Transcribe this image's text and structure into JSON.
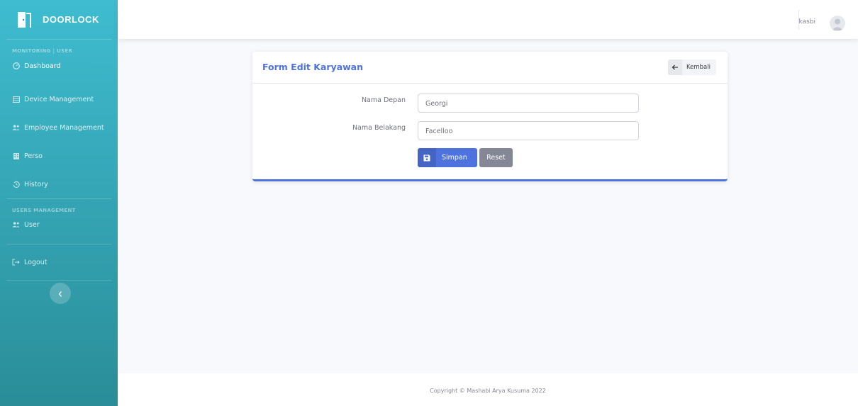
{
  "sidebar": {
    "brand": "DOORLOCK",
    "section_monitoring": "MONITORING | USER",
    "items": [
      {
        "label": "Dashboard",
        "icon": "dashboard-icon"
      },
      {
        "label": "Device Management",
        "icon": "table-icon"
      },
      {
        "label": "Employee Management",
        "icon": "users-icon"
      },
      {
        "label": "Perso",
        "icon": "building-icon"
      },
      {
        "label": "History",
        "icon": "history-icon"
      }
    ],
    "section_users": "USERS MANAGEMENT",
    "user_item": {
      "label": "User",
      "icon": "users-icon"
    },
    "logout_item": {
      "label": "Logout",
      "icon": "logout-icon"
    }
  },
  "topbar": {
    "username": "kasbi"
  },
  "card": {
    "title": "Form Edit Karyawan",
    "back_label": "Kembali",
    "fields": [
      {
        "label": "Nama Depan",
        "value": "Georgi"
      },
      {
        "label": "Nama Belakang",
        "value": "Facelloo"
      }
    ],
    "save_label": "Simpan",
    "reset_label": "Reset"
  },
  "footer": {
    "copyright": "Copyright © Mashabi Arya Kusuma 2022"
  },
  "colors": {
    "primary": "#4e73df",
    "sidebar_top": "#3fbcd0",
    "sidebar_bottom": "#2a8d98",
    "secondary": "#858796"
  }
}
